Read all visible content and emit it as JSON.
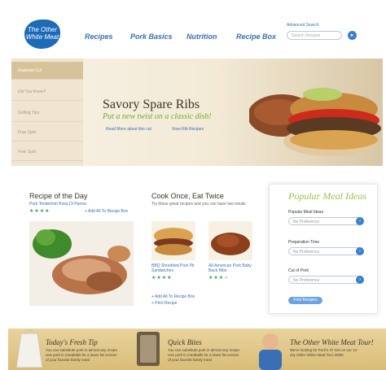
{
  "header": {
    "logo_text": "The Other White Meat",
    "nav": [
      "Recipes",
      "Pork Basics",
      "Nutrition",
      "Recipe Box"
    ],
    "advanced_search": "Advanced Search",
    "search_placeholder": "Search Recipes"
  },
  "hero": {
    "tabs": [
      "Featured Cut",
      "Did You Know?",
      "Grilling Tips",
      "Free Spot",
      "Free Spot"
    ],
    "title": "Savory Spare Ribs",
    "tagline": "Put a new twist on a classic dish!",
    "links": [
      "Read More about this cut",
      "View Rib Recipes"
    ]
  },
  "recipe_of_day": {
    "heading": "Recipe of the Day",
    "name": "Pork Tenderloin Rosa Di Parma",
    "stars": "★★★★",
    "add_link": "+ Add All To Recipe Box"
  },
  "cook_once": {
    "heading": "Cook Once, Eat Twice",
    "subtitle": "Try these great recipes and you can have two meals",
    "items": [
      {
        "name": "BBQ Shredded Pork Pit Sandwiches",
        "stars": "★★★★"
      },
      {
        "name": "All-American Pork Baby Back Ribs",
        "stars": "★★★☆"
      }
    ],
    "add_link": "+ Add All To Recipe Box",
    "print_link": "+ Print Recipe"
  },
  "sidebar": {
    "title": "Popular Meal Ideas",
    "fields": [
      {
        "label": "Popular Meal Ideas",
        "value": "No Preference"
      },
      {
        "label": "Preparation Time",
        "value": "No Preference"
      },
      {
        "label": "Cut of Pork",
        "value": "No Preference"
      }
    ],
    "button": "Find Recipes"
  },
  "footer": {
    "blocks": [
      {
        "title": "Today's Fresh Tip",
        "text": "You can substitute pork in almost any recipe. Use pork in meatballs for a lower fat version of your favorite family meal"
      },
      {
        "title": "Quick Bites",
        "text": "You can substitute pork in almost any recipe. Use pork in meatballs for a lower fat version of your favorite family meal"
      },
      {
        "title": "The Other White Meat Tour!",
        "text": "We're looking for Pork'n it? Get on our 12-city Other White Meat Tour 2008!"
      }
    ]
  },
  "colors": {
    "brand_blue": "#1c6ab8",
    "link_blue": "#3a6fb6",
    "green": "#6fae2e",
    "tan": "#d7c39a"
  }
}
